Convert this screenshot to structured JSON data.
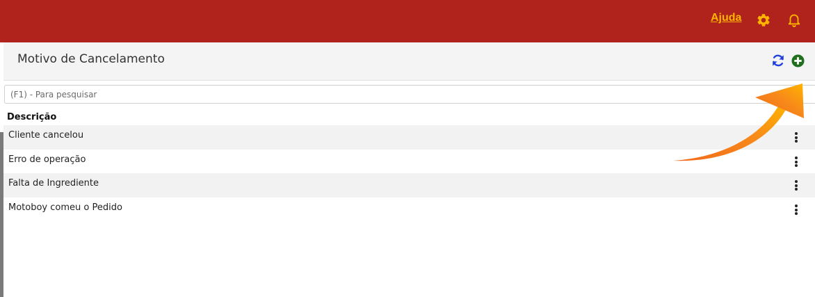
{
  "topbar": {
    "help_label": "Ajuda",
    "background": "#af231c",
    "accent": "#ffb400",
    "settings_icon": "gear-icon",
    "notifications_icon": "bell-icon"
  },
  "header": {
    "title": "Motivo de Cancelamento",
    "refresh_icon": "refresh-icon",
    "add_icon": "add-circle-icon",
    "refresh_color": "#1f3fe0",
    "add_color": "#1f6f1f"
  },
  "search": {
    "placeholder": "(F1) - Para pesquisar",
    "value": ""
  },
  "table": {
    "column_header": "Descrição",
    "rows": [
      {
        "label": "Cliente cancelou"
      },
      {
        "label": "Erro de operação"
      },
      {
        "label": "Falta de Ingrediente"
      },
      {
        "label": "Motoboy comeu o Pedido"
      }
    ],
    "row_menu_icon": "kebab-menu-icon"
  },
  "annotation": {
    "arrow_icon": "curved-arrow-icon",
    "arrow_colors": [
      "#ffb400",
      "#f26a1b"
    ]
  }
}
